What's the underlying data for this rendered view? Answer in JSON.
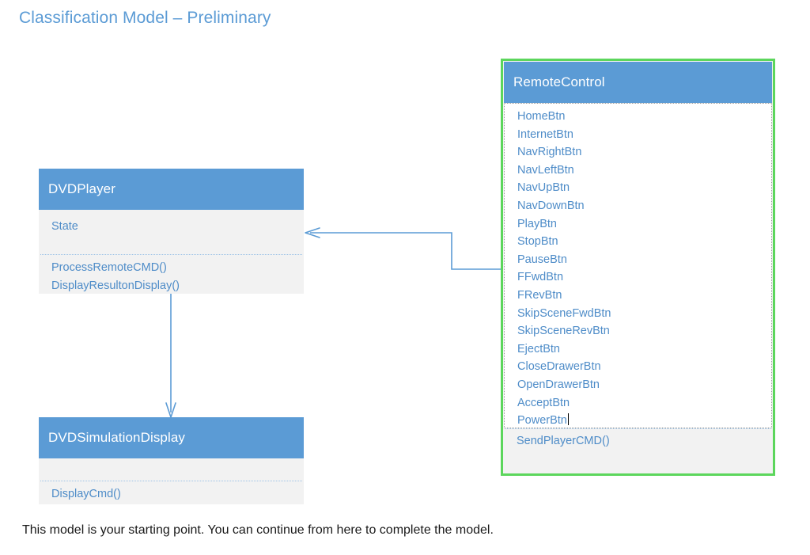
{
  "slide": {
    "title": "Classification Model – Preliminary",
    "caption": "This model is your starting point. You can continue from here to complete the model."
  },
  "colors": {
    "header_fill": "#5B9BD5",
    "body_fill": "#F2F2F2",
    "text_blue": "#4E8CC8",
    "title_blue": "#5B9BD5",
    "selection_green": "#5CD65C",
    "connector_blue": "#5B9BD5",
    "caption_black": "#1a1a1a"
  },
  "classes": {
    "dvdplayer": {
      "name": "DVDPlayer",
      "attributes": [
        "State"
      ],
      "operations": [
        "ProcessRemoteCMD()",
        "DisplayResultonDisplay()"
      ]
    },
    "dvdsimulationdisplay": {
      "name": "DVDSimulationDisplay",
      "attributes": [],
      "operations": [
        "DisplayCmd()"
      ]
    },
    "remotecontrol": {
      "name": "RemoteControl",
      "selected": "true",
      "editing_section": "attributes",
      "attributes": [
        "HomeBtn",
        "InternetBtn",
        "NavRightBtn",
        "NavLeftBtn",
        "NavUpBtn",
        "NavDownBtn",
        "PlayBtn",
        "StopBtn",
        "PauseBtn",
        "FFwdBtn",
        "FRevBtn",
        "SkipSceneFwdBtn",
        "SkipSceneRevBtn",
        "EjectBtn",
        "CloseDrawerBtn",
        "OpenDrawerBtn",
        "AcceptBtn",
        "PowerBtn"
      ],
      "operations": [
        "SendPlayerCMD()"
      ]
    }
  },
  "connectors": [
    {
      "name": "remotecontrol-to-dvdplayer",
      "from": "RemoteControl",
      "to": "DVDPlayer",
      "style": "elbow",
      "arrowhead": "open"
    },
    {
      "name": "dvdplayer-to-dvdsimulationdisplay",
      "from": "DVDPlayer",
      "to": "DVDSimulationDisplay",
      "style": "straight",
      "arrowhead": "open"
    }
  ]
}
